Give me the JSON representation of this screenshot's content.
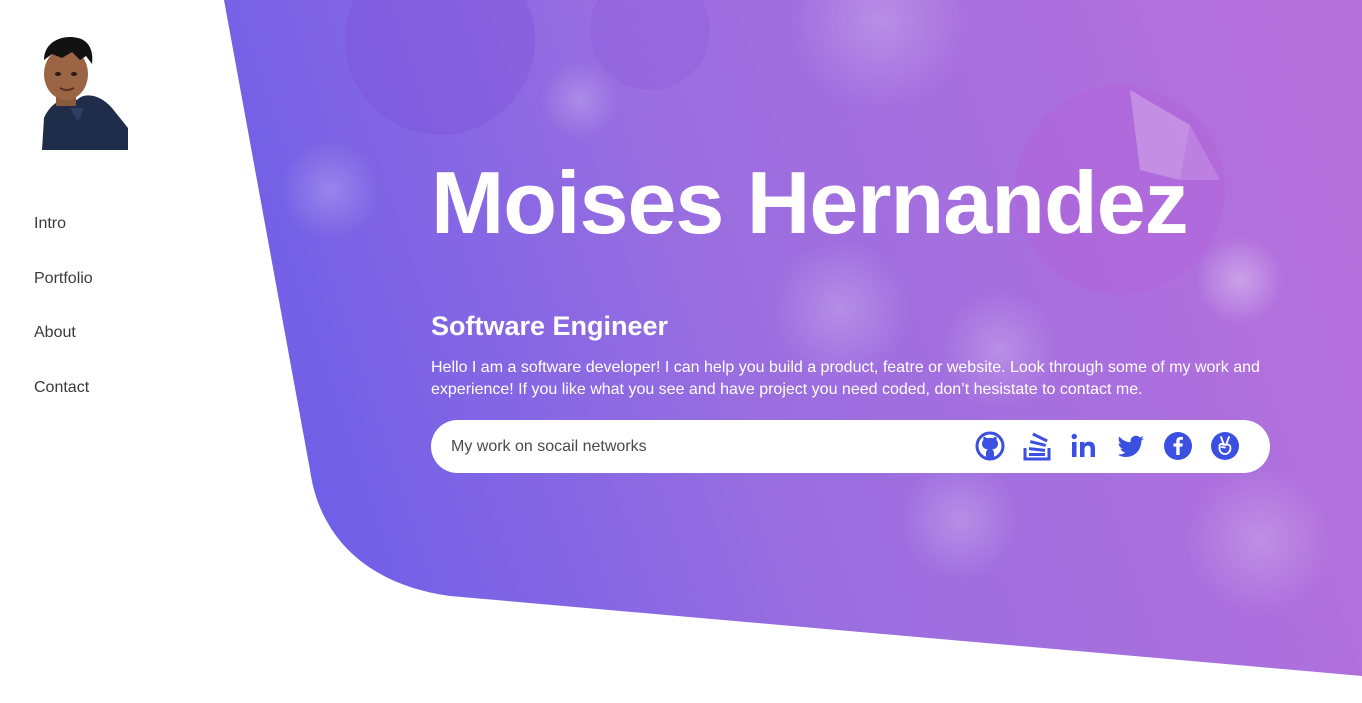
{
  "nav": {
    "items": [
      {
        "label": "Intro"
      },
      {
        "label": "Portfolio"
      },
      {
        "label": "About"
      },
      {
        "label": "Contact"
      }
    ]
  },
  "hero": {
    "name": "Moises Hernandez",
    "role": "Software Engineer",
    "description": "Hello I am a software developer! I can help you build a product, featre or website. Look through some of my work and experience! If you like what you see and have project you need coded, don’t hesistate to contact me."
  },
  "social": {
    "label": "My work on socail networks",
    "icons": [
      "github-icon",
      "stackoverflow-icon",
      "linkedin-icon",
      "twitter-icon",
      "facebook-icon",
      "angellist-icon"
    ]
  },
  "colors": {
    "gradient_start": "#6c5ce7",
    "gradient_end": "#b46ede",
    "icon_blue": "#3b4fe0"
  }
}
